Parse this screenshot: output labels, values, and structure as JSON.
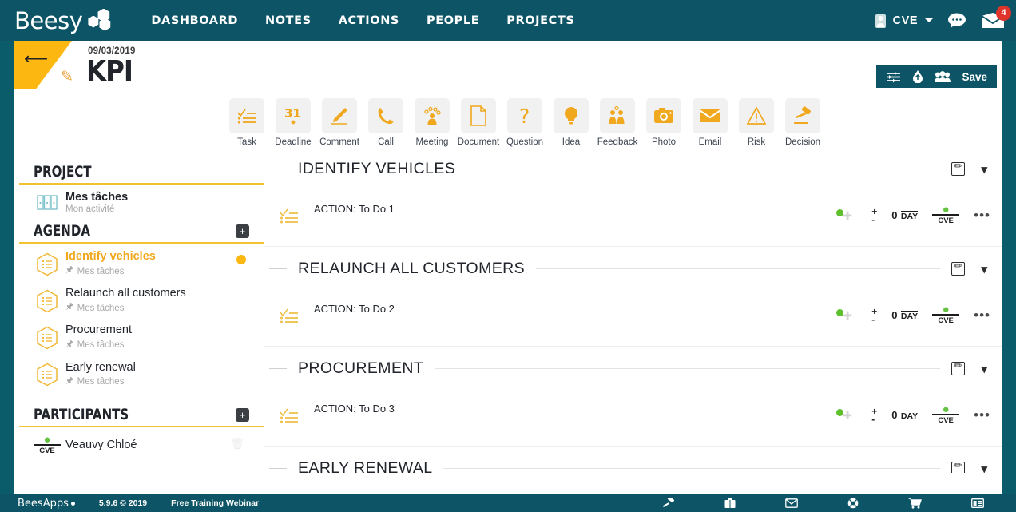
{
  "brand": {
    "logo_text": "Beesy",
    "accent_yellow": "#fcb711",
    "teal": "#0d5566",
    "amber": "#f0a81e",
    "green": "#5ec02c"
  },
  "topnav": {
    "links": [
      {
        "label": "DASHBOARD"
      },
      {
        "label": "NOTES"
      },
      {
        "label": "ACTIONS"
      },
      {
        "label": "PEOPLE"
      },
      {
        "label": "PROJECTS"
      }
    ],
    "user": {
      "initials": "CVE"
    },
    "chat_icon": "chat-bubble-icon",
    "mail": {
      "icon": "envelope-icon",
      "badge_count": "4"
    }
  },
  "titlebar": {
    "back_icon": "back-arrow-icon",
    "edit_icon": "pencil-icon",
    "date": "09/03/2019",
    "title": "KPI",
    "toolbar": {
      "filter_icon": "sliders-icon",
      "export_icon": "upload-drop-icon",
      "people_icon": "people-group-icon",
      "save_label": "Save"
    }
  },
  "palette": [
    {
      "label": "Task",
      "icon": "checklist-icon"
    },
    {
      "label": "Deadline",
      "icon": "calendar-31-icon"
    },
    {
      "label": "Comment",
      "icon": "pencil-underline-icon"
    },
    {
      "label": "Call",
      "icon": "phone-icon"
    },
    {
      "label": "Meeting",
      "icon": "meeting-people-icon"
    },
    {
      "label": "Document",
      "icon": "document-icon"
    },
    {
      "label": "Question",
      "icon": "question-mark-icon"
    },
    {
      "label": "Idea",
      "icon": "lightbulb-icon"
    },
    {
      "label": "Feedback",
      "icon": "feedback-people-icon"
    },
    {
      "label": "Photo",
      "icon": "camera-icon"
    },
    {
      "label": "Email",
      "icon": "envelope-icon"
    },
    {
      "label": "Risk",
      "icon": "warning-triangle-icon"
    },
    {
      "label": "Decision",
      "icon": "gavel-icon"
    }
  ],
  "sidebar": {
    "project": {
      "heading": "PROJECT",
      "item": {
        "title": "Mes tâches",
        "subtitle": "Mon activité",
        "icon": "binders-icon"
      }
    },
    "agenda": {
      "heading": "AGENDA",
      "add_icon": "plus-icon",
      "items": [
        {
          "title": "Identify vehicles",
          "subtitle": "Mes tâches",
          "selected": true,
          "has_dot": true
        },
        {
          "title": "Relaunch all customers",
          "subtitle": "Mes tâches",
          "selected": false,
          "has_dot": false
        },
        {
          "title": "Procurement",
          "subtitle": "Mes tâches",
          "selected": false,
          "has_dot": false
        },
        {
          "title": "Early renewal",
          "subtitle": "Mes tâches",
          "selected": false,
          "has_dot": false
        }
      ]
    },
    "participants": {
      "heading": "PARTICIPANTS",
      "add_icon": "plus-icon",
      "items": [
        {
          "name": "Veauvy Chloé",
          "initials": "CVE",
          "delete_icon": "trash-icon"
        }
      ]
    }
  },
  "main": {
    "groups": [
      {
        "title": "IDENTIFY VEHICLES",
        "edit_icon": "edit-square-icon",
        "collapse_icon": "chevron-down-icon",
        "actions": [
          {
            "text": "ACTION: To Do 1",
            "icon": "checklist-icon",
            "status": "green",
            "plus": "+",
            "minus": "-",
            "day_value": "0",
            "day_label": "DAY",
            "assignee": "CVE",
            "more_icon": "ellipsis-icon"
          }
        ]
      },
      {
        "title": "RELAUNCH ALL CUSTOMERS",
        "edit_icon": "edit-square-icon",
        "collapse_icon": "chevron-down-icon",
        "actions": [
          {
            "text": "ACTION: To Do 2",
            "icon": "checklist-icon",
            "status": "green",
            "plus": "+",
            "minus": "-",
            "day_value": "0",
            "day_label": "DAY",
            "assignee": "CVE",
            "more_icon": "ellipsis-icon"
          }
        ]
      },
      {
        "title": "PROCUREMENT",
        "edit_icon": "edit-square-icon",
        "collapse_icon": "chevron-down-icon",
        "actions": [
          {
            "text": "ACTION: To Do 3",
            "icon": "checklist-icon",
            "status": "green",
            "plus": "+",
            "minus": "-",
            "day_value": "0",
            "day_label": "DAY",
            "assignee": "CVE",
            "more_icon": "ellipsis-icon"
          }
        ]
      },
      {
        "title": "EARLY RENEWAL",
        "edit_icon": "edit-square-icon",
        "collapse_icon": "chevron-down-icon",
        "actions": []
      }
    ]
  },
  "footer": {
    "logo_text": "BeesApps",
    "version": "5.9.6 © 2019",
    "promo": "Free Training Webinar",
    "icons": [
      {
        "name": "hammer-icon"
      },
      {
        "name": "briefcase-icon"
      },
      {
        "name": "envelope-icon"
      },
      {
        "name": "lifering-help-icon"
      },
      {
        "name": "shopping-cart-icon"
      },
      {
        "name": "id-card-icon"
      }
    ]
  }
}
